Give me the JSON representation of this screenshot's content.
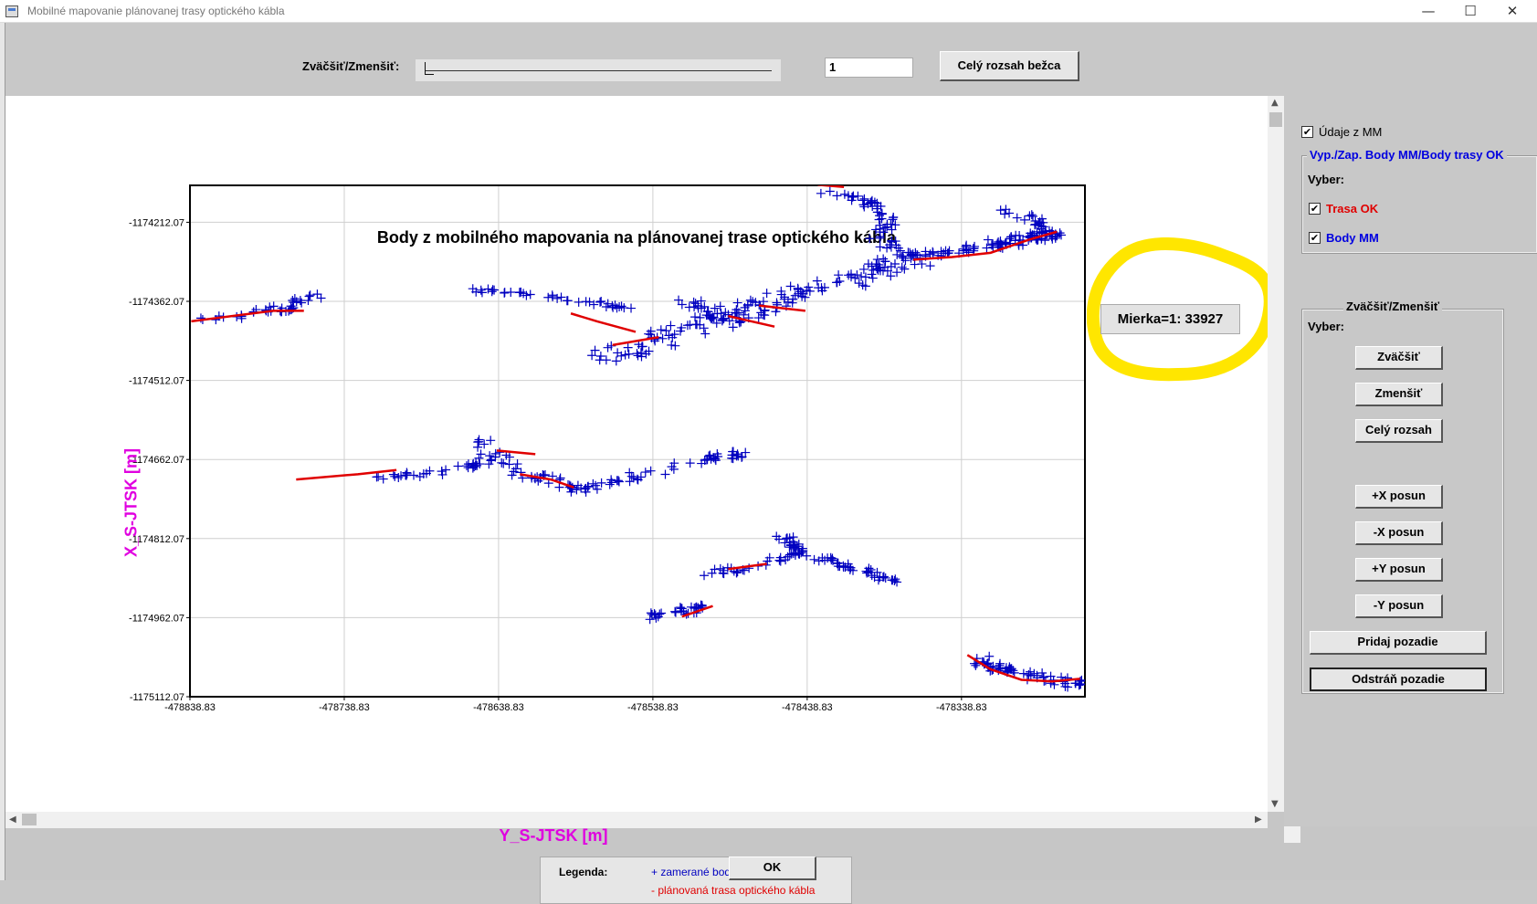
{
  "window": {
    "title": "Mobilné mapovanie plánovanej trasy optického kábla",
    "minimize": "—",
    "maximize": "☐",
    "close": "✕"
  },
  "toolbar": {
    "zoom_label": "Zväčšiť/Zmenšiť:",
    "zoom_value": "1",
    "full_range_button": "Celý rozsah bežca"
  },
  "scale": {
    "label": "Mierka=1: 33927"
  },
  "legend": {
    "title": "Legenda:",
    "item1": "+ zamerané body",
    "item2": "- plánovaná trasa optického kábla"
  },
  "right_panel": {
    "mm_data_label": "Údaje z MM",
    "mm_data_checked": true,
    "layers_group": {
      "title": "Vyp./Zap. Body MM/Body trasy OK",
      "choose_label": "Vyber:",
      "trasa_ok_label": "Trasa OK",
      "trasa_ok_checked": true,
      "body_mm_label": "Body MM",
      "body_mm_checked": true
    },
    "zoom_group": {
      "title": "Zväčšiť/Zmenšiť",
      "choose_label": "Vyber:",
      "zoom_in": "Zväčšiť",
      "zoom_out": "Zmenšiť",
      "full_range": "Celý rozsah",
      "plus_x": "+X posun",
      "minus_x": "-X posun",
      "plus_y": "+Y posun",
      "minus_y": "-Y posun",
      "add_background": "Pridaj pozadie",
      "remove_background": "Odstráň pozadie"
    }
  },
  "ok_button": "OK",
  "colors": {
    "points": "#0000c0",
    "route": "#e00000",
    "axis_label": "#e000e0",
    "highlight": "#ffe600"
  },
  "chart_data": {
    "type": "scatter",
    "title": "Body z mobilného mapovania na plánovanej trase optického kábla",
    "xlabel": "Y_S-JTSK [m]",
    "ylabel": "X_S-JTSK [m]",
    "xlim": [
      -478838.83,
      -478258.83
    ],
    "ylim": [
      -1175112.07,
      -1174142.07
    ],
    "x_ticks": [
      "-478838.83",
      "-478738.83",
      "-478638.83",
      "-478538.83",
      "-478438.83",
      "-478338.83"
    ],
    "y_ticks": [
      "-1174212.07",
      "-1174362.07",
      "-1174512.07",
      "-1174662.07",
      "-1174812.07",
      "-1174962.07",
      "-1175112.07"
    ],
    "grid": true,
    "series": [
      {
        "name": "zamerané body",
        "marker": "+",
        "clusters": [
          {
            "path": [
              [
                -478838,
                -1174400
              ],
              [
                -478810,
                -1174390
              ],
              [
                -478790,
                -1174380
              ],
              [
                -478775,
                -1174375
              ],
              [
                -478763,
                -1174355
              ],
              [
                -478750,
                -1174350
              ]
            ],
            "spread": 6,
            "n": 40
          },
          {
            "path": [
              [
                -478655,
                -1174340
              ],
              [
                -478620,
                -1174350
              ],
              [
                -478580,
                -1174362
              ],
              [
                -478555,
                -1174375
              ]
            ],
            "spread": 4,
            "n": 40
          },
          {
            "path": [
              [
                -478570,
                -1174470
              ],
              [
                -478520,
                -1174420
              ],
              [
                -478480,
                -1174380
              ],
              [
                -478450,
                -1174350
              ],
              [
                -478400,
                -1174310
              ],
              [
                -478370,
                -1174280
              ]
            ],
            "spread": 14,
            "n": 160
          },
          {
            "path": [
              [
                -478370,
                -1174280
              ],
              [
                -478340,
                -1174265
              ],
              [
                -478310,
                -1174250
              ],
              [
                -478290,
                -1174240
              ],
              [
                -478280,
                -1174235
              ]
            ],
            "spread": 8,
            "n": 90
          },
          {
            "path": [
              [
                -478430,
                -1174150
              ],
              [
                -478400,
                -1174170
              ],
              [
                -478385,
                -1174210
              ],
              [
                -478395,
                -1174240
              ],
              [
                -478370,
                -1174280
              ]
            ],
            "spread": 6,
            "n": 60
          },
          {
            "path": [
              [
                -478310,
                -1174190
              ],
              [
                -478290,
                -1174210
              ],
              [
                -478280,
                -1174240
              ]
            ],
            "spread": 5,
            "n": 25
          },
          {
            "path": [
              [
                -478520,
                -1174360
              ],
              [
                -478500,
                -1174380
              ],
              [
                -478480,
                -1174395
              ]
            ],
            "spread": 10,
            "n": 30
          },
          {
            "path": [
              [
                -478720,
                -1174700
              ],
              [
                -478690,
                -1174690
              ],
              [
                -478660,
                -1174680
              ],
              [
                -478645,
                -1174660
              ],
              [
                -478648,
                -1174620
              ]
            ],
            "spread": 6,
            "n": 45
          },
          {
            "path": [
              [
                -478640,
                -1174640
              ],
              [
                -478625,
                -1174690
              ],
              [
                -478605,
                -1174700
              ],
              [
                -478585,
                -1174720
              ]
            ],
            "spread": 6,
            "n": 40
          },
          {
            "path": [
              [
                -478585,
                -1174720
              ],
              [
                -478560,
                -1174700
              ],
              [
                -478530,
                -1174680
              ],
              [
                -478500,
                -1174660
              ],
              [
                -478480,
                -1174650
              ]
            ],
            "spread": 6,
            "n": 55
          },
          {
            "path": [
              [
                -478510,
                -1174880
              ],
              [
                -478480,
                -1174870
              ],
              [
                -478455,
                -1174850
              ],
              [
                -478445,
                -1174830
              ],
              [
                -478455,
                -1174810
              ]
            ],
            "spread": 6,
            "n": 55
          },
          {
            "path": [
              [
                -478450,
                -1174840
              ],
              [
                -478420,
                -1174860
              ],
              [
                -478400,
                -1174875
              ],
              [
                -478385,
                -1174890
              ]
            ],
            "spread": 6,
            "n": 45
          },
          {
            "path": [
              [
                -478545,
                -1174960
              ],
              [
                -478520,
                -1174950
              ],
              [
                -478505,
                -1174940
              ]
            ],
            "spread": 6,
            "n": 30
          },
          {
            "path": [
              [
                -478330,
                -1175040
              ],
              [
                -478310,
                -1175060
              ],
              [
                -478280,
                -1175080
              ],
              [
                -478262,
                -1175090
              ]
            ],
            "spread": 8,
            "n": 65
          }
        ]
      },
      {
        "name": "plánovaná trasa optického kábla",
        "lines": [
          [
            [
              -478838,
              -1174400
            ],
            [
              -478785,
              -1174380
            ],
            [
              -478765,
              -1174380
            ]
          ],
          [
            [
              -478592,
              -1174385
            ],
            [
              -478575,
              -1174400
            ],
            [
              -478550,
              -1174420
            ]
          ],
          [
            [
              -478565,
              -1174445
            ],
            [
              -478535,
              -1174430
            ]
          ],
          [
            [
              -478490,
              -1174390
            ],
            [
              -478460,
              -1174410
            ]
          ],
          [
            [
              -478470,
              -1174370
            ],
            [
              -478440,
              -1174380
            ]
          ],
          [
            [
              -478370,
              -1174283
            ],
            [
              -478345,
              -1174278
            ],
            [
              -478320,
              -1174270
            ],
            [
              -478295,
              -1174245
            ],
            [
              -478277,
              -1174230
            ]
          ],
          [
            [
              -478432,
              -1174141
            ],
            [
              -478415,
              -1174145
            ]
          ],
          [
            [
              -478770,
              -1174700
            ],
            [
              -478730,
              -1174690
            ],
            [
              -478705,
              -1174682
            ]
          ],
          [
            [
              -478640,
              -1174645
            ],
            [
              -478615,
              -1174652
            ]
          ],
          [
            [
              -478625,
              -1174690
            ],
            [
              -478605,
              -1174700
            ],
            [
              -478590,
              -1174715
            ]
          ],
          [
            [
              -478490,
              -1174870
            ],
            [
              -478465,
              -1174860
            ]
          ],
          [
            [
              -478520,
              -1174960
            ],
            [
              -478500,
              -1174940
            ]
          ],
          [
            [
              -478335,
              -1175033
            ],
            [
              -478320,
              -1175060
            ],
            [
              -478300,
              -1175080
            ],
            [
              -478280,
              -1175083
            ],
            [
              -478262,
              -1175078
            ]
          ]
        ]
      }
    ]
  }
}
